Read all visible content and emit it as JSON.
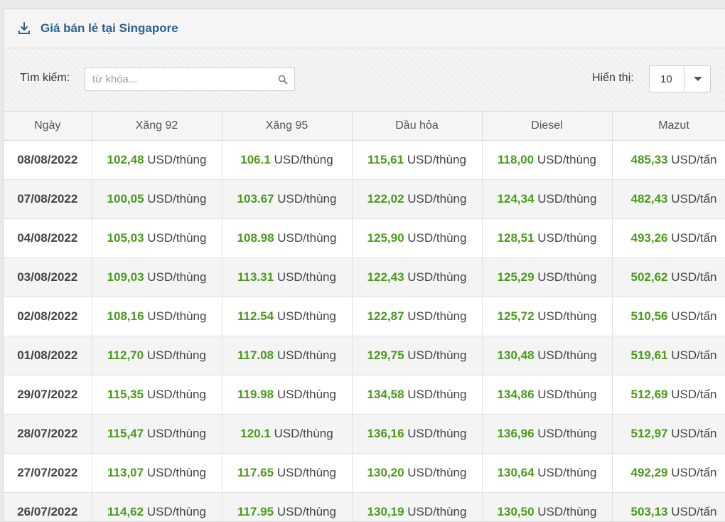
{
  "panel": {
    "title": "Giá bán lẻ tại Singapore"
  },
  "search": {
    "label": "Tìm kiếm:",
    "placeholder": "từ khóa...",
    "value": ""
  },
  "page_size": {
    "label": "Hiển thị:",
    "value": "10"
  },
  "table": {
    "headers": [
      "Ngày",
      "Xăng 92",
      "Xăng 95",
      "Dầu hỏa",
      "Diesel",
      "Mazut"
    ],
    "rows": [
      {
        "date": "08/08/2022",
        "cells": [
          {
            "value": "102,48",
            "unit": "USD/thùng"
          },
          {
            "value": "106.1",
            "unit": "USD/thùng"
          },
          {
            "value": "115,61",
            "unit": "USD/thùng"
          },
          {
            "value": "118,00",
            "unit": "USD/thùng"
          },
          {
            "value": "485,33",
            "unit": "USD/tấn"
          }
        ]
      },
      {
        "date": "07/08/2022",
        "cells": [
          {
            "value": "100,05",
            "unit": "USD/thùng"
          },
          {
            "value": "103.67",
            "unit": "USD/thùng"
          },
          {
            "value": "122,02",
            "unit": "USD/thùng"
          },
          {
            "value": "124,34",
            "unit": "USD/thùng"
          },
          {
            "value": "482,43",
            "unit": "USD/tấn"
          }
        ]
      },
      {
        "date": "04/08/2022",
        "cells": [
          {
            "value": "105,03",
            "unit": "USD/thùng"
          },
          {
            "value": "108.98",
            "unit": "USD/thùng"
          },
          {
            "value": "125,90",
            "unit": "USD/thùng"
          },
          {
            "value": "128,51",
            "unit": "USD/thùng"
          },
          {
            "value": "493,26",
            "unit": "USD/tấn"
          }
        ]
      },
      {
        "date": "03/08/2022",
        "cells": [
          {
            "value": "109,03",
            "unit": "USD/thùng"
          },
          {
            "value": "113.31",
            "unit": "USD/thùng"
          },
          {
            "value": "122,43",
            "unit": "USD/thùng"
          },
          {
            "value": "125,29",
            "unit": "USD/thùng"
          },
          {
            "value": "502,62",
            "unit": "USD/tấn"
          }
        ]
      },
      {
        "date": "02/08/2022",
        "cells": [
          {
            "value": "108,16",
            "unit": "USD/thùng"
          },
          {
            "value": "112.54",
            "unit": "USD/thùng"
          },
          {
            "value": "122,87",
            "unit": "USD/thùng"
          },
          {
            "value": "125,72",
            "unit": "USD/thùng"
          },
          {
            "value": "510,56",
            "unit": "USD/tấn"
          }
        ]
      },
      {
        "date": "01/08/2022",
        "cells": [
          {
            "value": "112,70",
            "unit": "USD/thùng"
          },
          {
            "value": "117.08",
            "unit": "USD/thùng"
          },
          {
            "value": "129,75",
            "unit": "USD/thùng"
          },
          {
            "value": "130,48",
            "unit": "USD/thùng"
          },
          {
            "value": "519,61",
            "unit": "USD/tấn"
          }
        ]
      },
      {
        "date": "29/07/2022",
        "cells": [
          {
            "value": "115,35",
            "unit": "USD/thùng"
          },
          {
            "value": "119.98",
            "unit": "USD/thùng"
          },
          {
            "value": "134,58",
            "unit": "USD/thùng"
          },
          {
            "value": "134,86",
            "unit": "USD/thùng"
          },
          {
            "value": "512,69",
            "unit": "USD/tấn"
          }
        ]
      },
      {
        "date": "28/07/2022",
        "cells": [
          {
            "value": "115,47",
            "unit": "USD/thùng"
          },
          {
            "value": "120.1",
            "unit": "USD/thùng"
          },
          {
            "value": "136,16",
            "unit": "USD/thùng"
          },
          {
            "value": "136,96",
            "unit": "USD/thùng"
          },
          {
            "value": "512,97",
            "unit": "USD/tấn"
          }
        ]
      },
      {
        "date": "27/07/2022",
        "cells": [
          {
            "value": "113,07",
            "unit": "USD/thùng"
          },
          {
            "value": "117.65",
            "unit": "USD/thùng"
          },
          {
            "value": "130,20",
            "unit": "USD/thùng"
          },
          {
            "value": "130,64",
            "unit": "USD/thùng"
          },
          {
            "value": "492,29",
            "unit": "USD/tấn"
          }
        ]
      },
      {
        "date": "26/07/2022",
        "cells": [
          {
            "value": "114,62",
            "unit": "USD/thùng"
          },
          {
            "value": "117.95",
            "unit": "USD/thùng"
          },
          {
            "value": "130,19",
            "unit": "USD/thùng"
          },
          {
            "value": "130,50",
            "unit": "USD/thùng"
          },
          {
            "value": "503,13",
            "unit": "USD/tấn"
          }
        ]
      }
    ]
  },
  "colors": {
    "title": "#2c5f8a",
    "value_green": "#4a9a1c"
  },
  "icons": {
    "header": "download-icon",
    "search": "search-icon",
    "select": "caret-down-icon"
  }
}
